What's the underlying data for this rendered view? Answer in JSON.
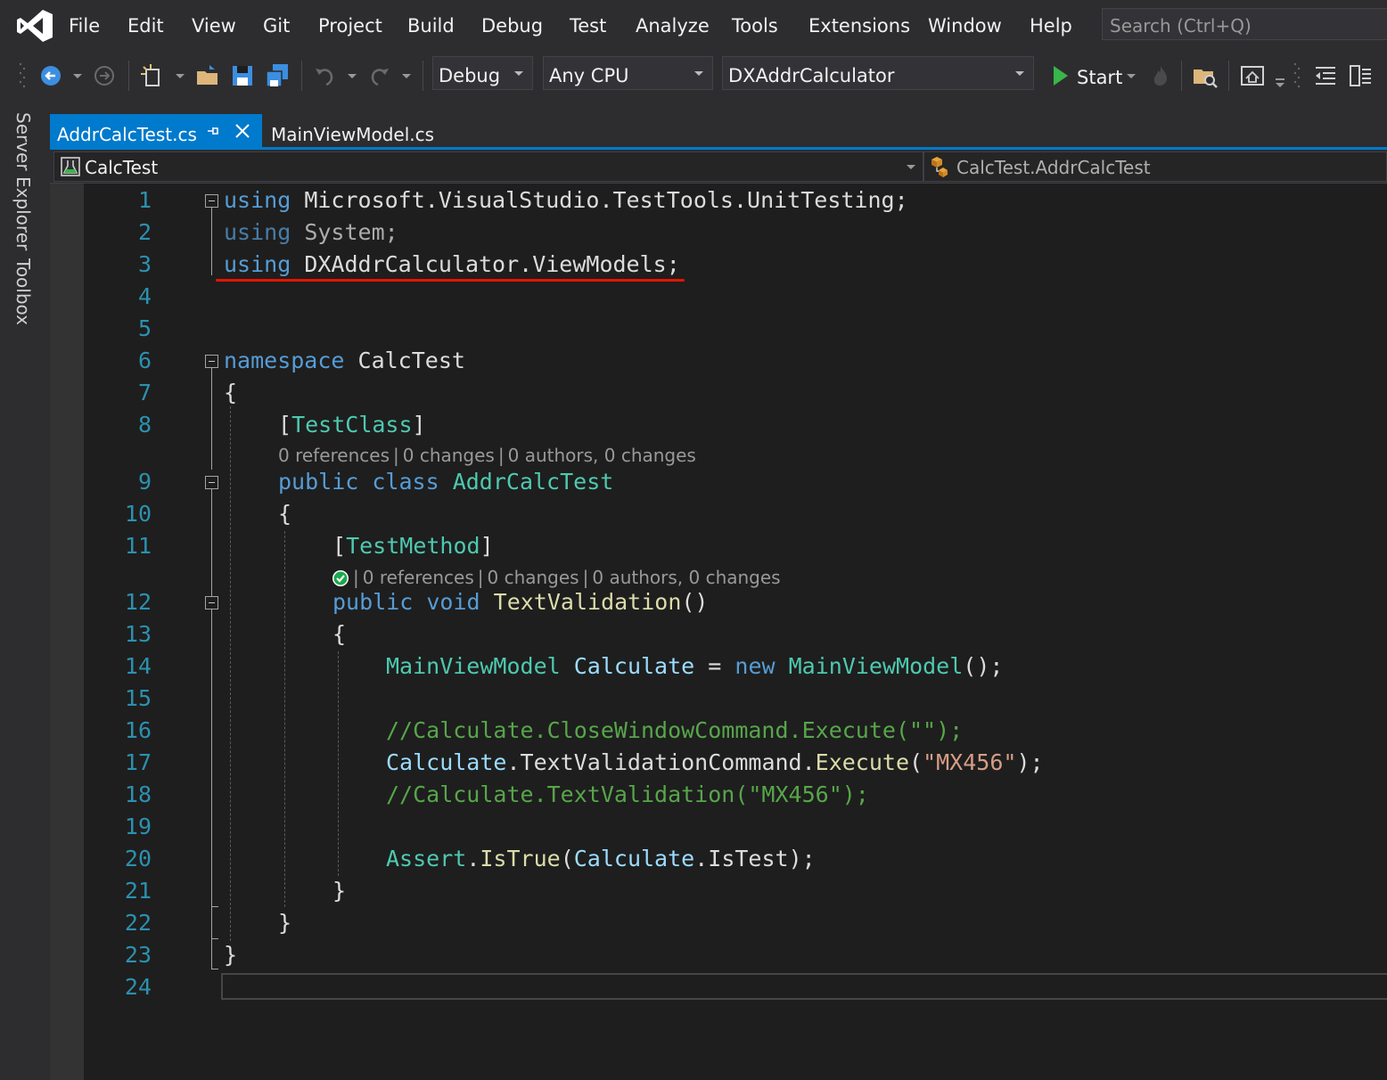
{
  "menu": [
    "File",
    "Edit",
    "View",
    "Git",
    "Project",
    "Build",
    "Debug",
    "Test",
    "Analyze",
    "Tools",
    "Extensions",
    "Window",
    "Help"
  ],
  "search": {
    "placeholder": "Search (Ctrl+Q)"
  },
  "toolbar": {
    "configuration": "Debug",
    "platform": "Any CPU",
    "startup_project": "DXAddrCalculator",
    "start_label": "Start"
  },
  "side_tabs": [
    "Server Explorer",
    "Toolbox"
  ],
  "tabs": [
    {
      "label": "AddrCalcTest.cs",
      "active": true
    },
    {
      "label": "MainViewModel.cs",
      "active": false
    }
  ],
  "navbar": {
    "project": "CalcTest",
    "type": "CalcTest.AddrCalcTest"
  },
  "codelens": {
    "class": {
      "references": "0 references",
      "changes": "0 changes",
      "authors": "0 authors, 0 changes"
    },
    "method": {
      "references": "0 references",
      "changes": "0 changes",
      "authors": "0 authors, 0 changes",
      "status_icon": "test-passed-icon"
    }
  },
  "code": {
    "l1": [
      "using",
      "Microsoft.VisualStudio.TestTools.UnitTesting;"
    ],
    "l2": [
      "using",
      "System;"
    ],
    "l3": [
      "using",
      "DXAddrCalculator.ViewModels;"
    ],
    "l6": [
      "namespace",
      "CalcTest"
    ],
    "l7": "{",
    "l8": [
      "[",
      "TestClass",
      "]"
    ],
    "l9": [
      "public",
      "class",
      "AddrCalcTest"
    ],
    "l10": "{",
    "l11": [
      "[",
      "TestMethod",
      "]"
    ],
    "l12": [
      "public",
      "void",
      "TextValidation",
      "()"
    ],
    "l13": "{",
    "l14": [
      "MainViewModel",
      "Calculate",
      "=",
      "new",
      "MainViewModel",
      "();"
    ],
    "l16": "//Calculate.CloseWindowCommand.Execute(\"\");",
    "l17": [
      "Calculate",
      ".TextValidationCommand.",
      "Execute",
      "(",
      "\"MX456\"",
      ");"
    ],
    "l18": "//Calculate.TextValidation(\"MX456\");",
    "l20": [
      "Assert",
      ".",
      "IsTrue",
      "(",
      "Calculate",
      ".IsTest);"
    ],
    "l21": "}",
    "l22": "}",
    "l23": "}"
  },
  "line_numbers": [
    "1",
    "2",
    "3",
    "4",
    "5",
    "6",
    "7",
    "8",
    "9",
    "10",
    "11",
    "12",
    "13",
    "14",
    "15",
    "16",
    "17",
    "18",
    "19",
    "20",
    "21",
    "22",
    "23",
    "24"
  ],
  "colors": {
    "accent": "#007acc",
    "keyword": "#569cd6",
    "type": "#4ec9b0",
    "method": "#dcdcaa",
    "identifier": "#9cdcfe",
    "string": "#d69d85",
    "comment": "#57a64a",
    "line_number": "#2b91af",
    "underline": "#e51400"
  }
}
